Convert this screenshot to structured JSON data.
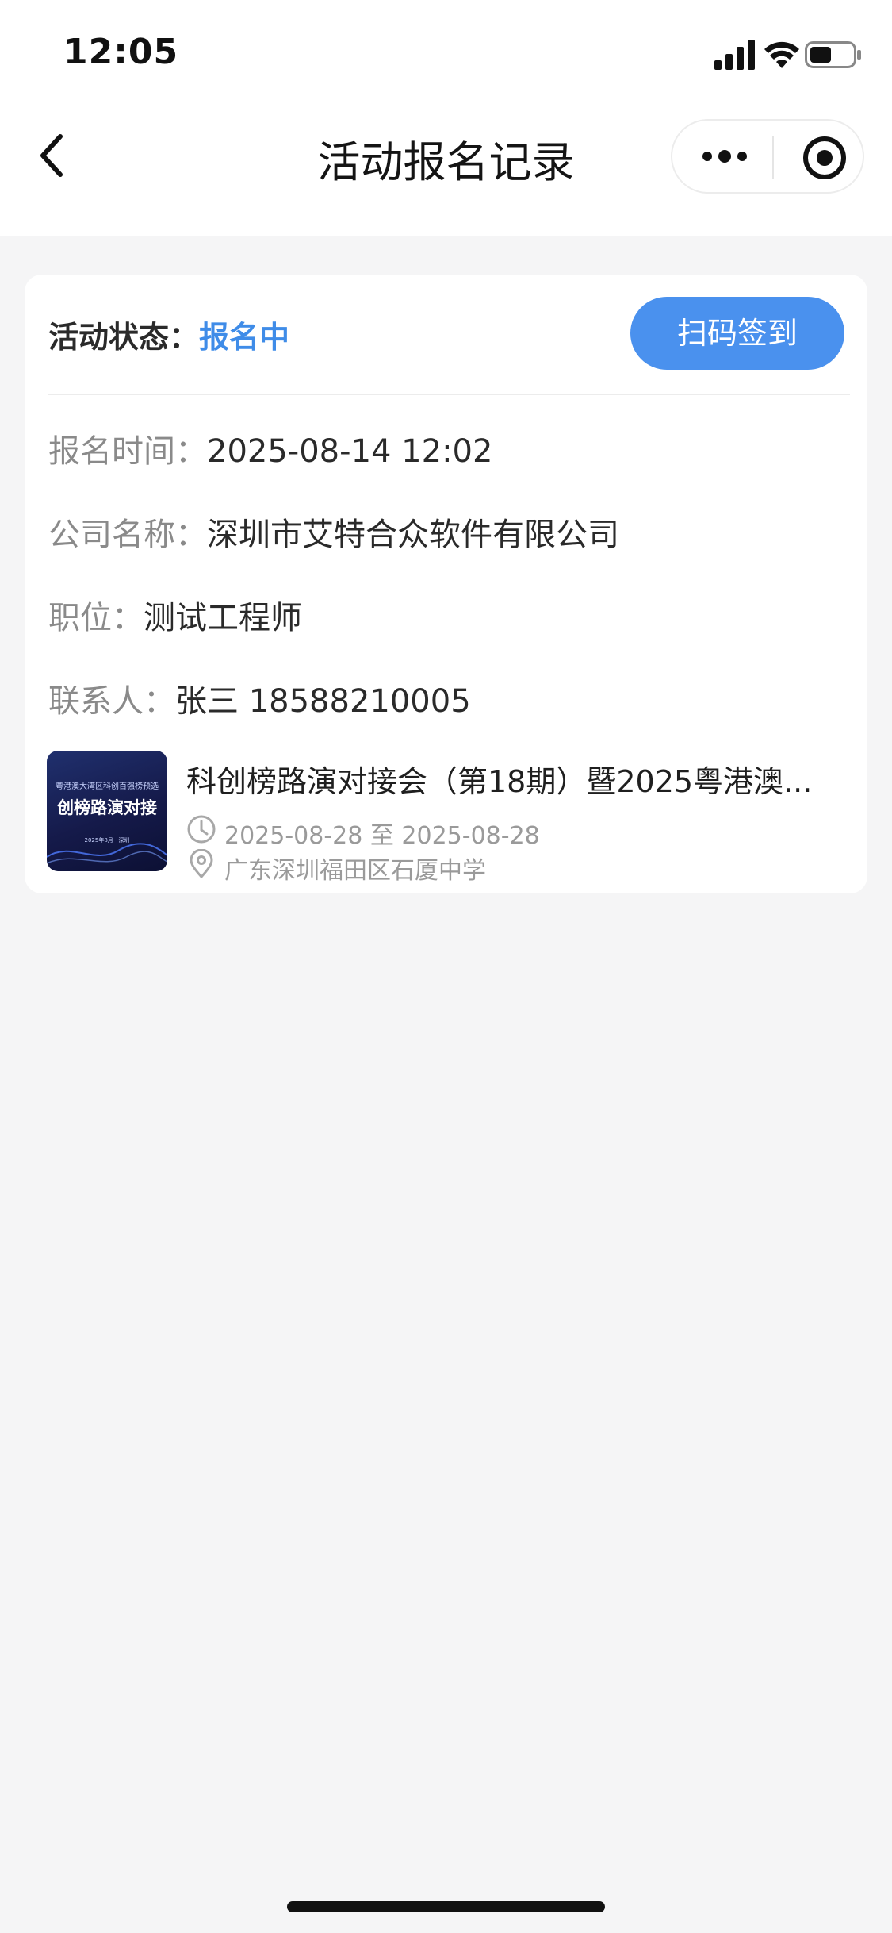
{
  "status_bar": {
    "time": "12:05",
    "icons": [
      "signal-icon",
      "wifi-icon",
      "battery-icon"
    ]
  },
  "nav": {
    "title": "活动报名记录",
    "back_icon": "chevron-left-icon",
    "more_icon": "more-dots-icon",
    "target_icon": "target-icon"
  },
  "card": {
    "status_label": "活动状态：",
    "status_value": "报名中",
    "scan_button": "扫码签到",
    "fields": [
      {
        "label": "报名时间：",
        "value": "2025-08-14 12:02"
      },
      {
        "label": "公司名称：",
        "value": "深圳市艾特合众软件有限公司"
      },
      {
        "label": "职位：",
        "value": "测试工程师"
      },
      {
        "label": "联系人：",
        "value": "张三 18588210005"
      }
    ],
    "event": {
      "title": "科创榜路演对接会（第18期）暨2025粤港澳...",
      "date": "2025-08-28 至 2025-08-28",
      "location": "广东深圳福田区石厦中学",
      "thumbnail": {
        "top_text": "粤港澳大湾区科创百强榜预选",
        "main_text": "创榜路演对接",
        "date_text": "2025年8月 · 深圳"
      }
    }
  },
  "colors": {
    "accent": "#4a91ee",
    "status_text": "#3f8ce8",
    "background": "#f5f5f6"
  }
}
